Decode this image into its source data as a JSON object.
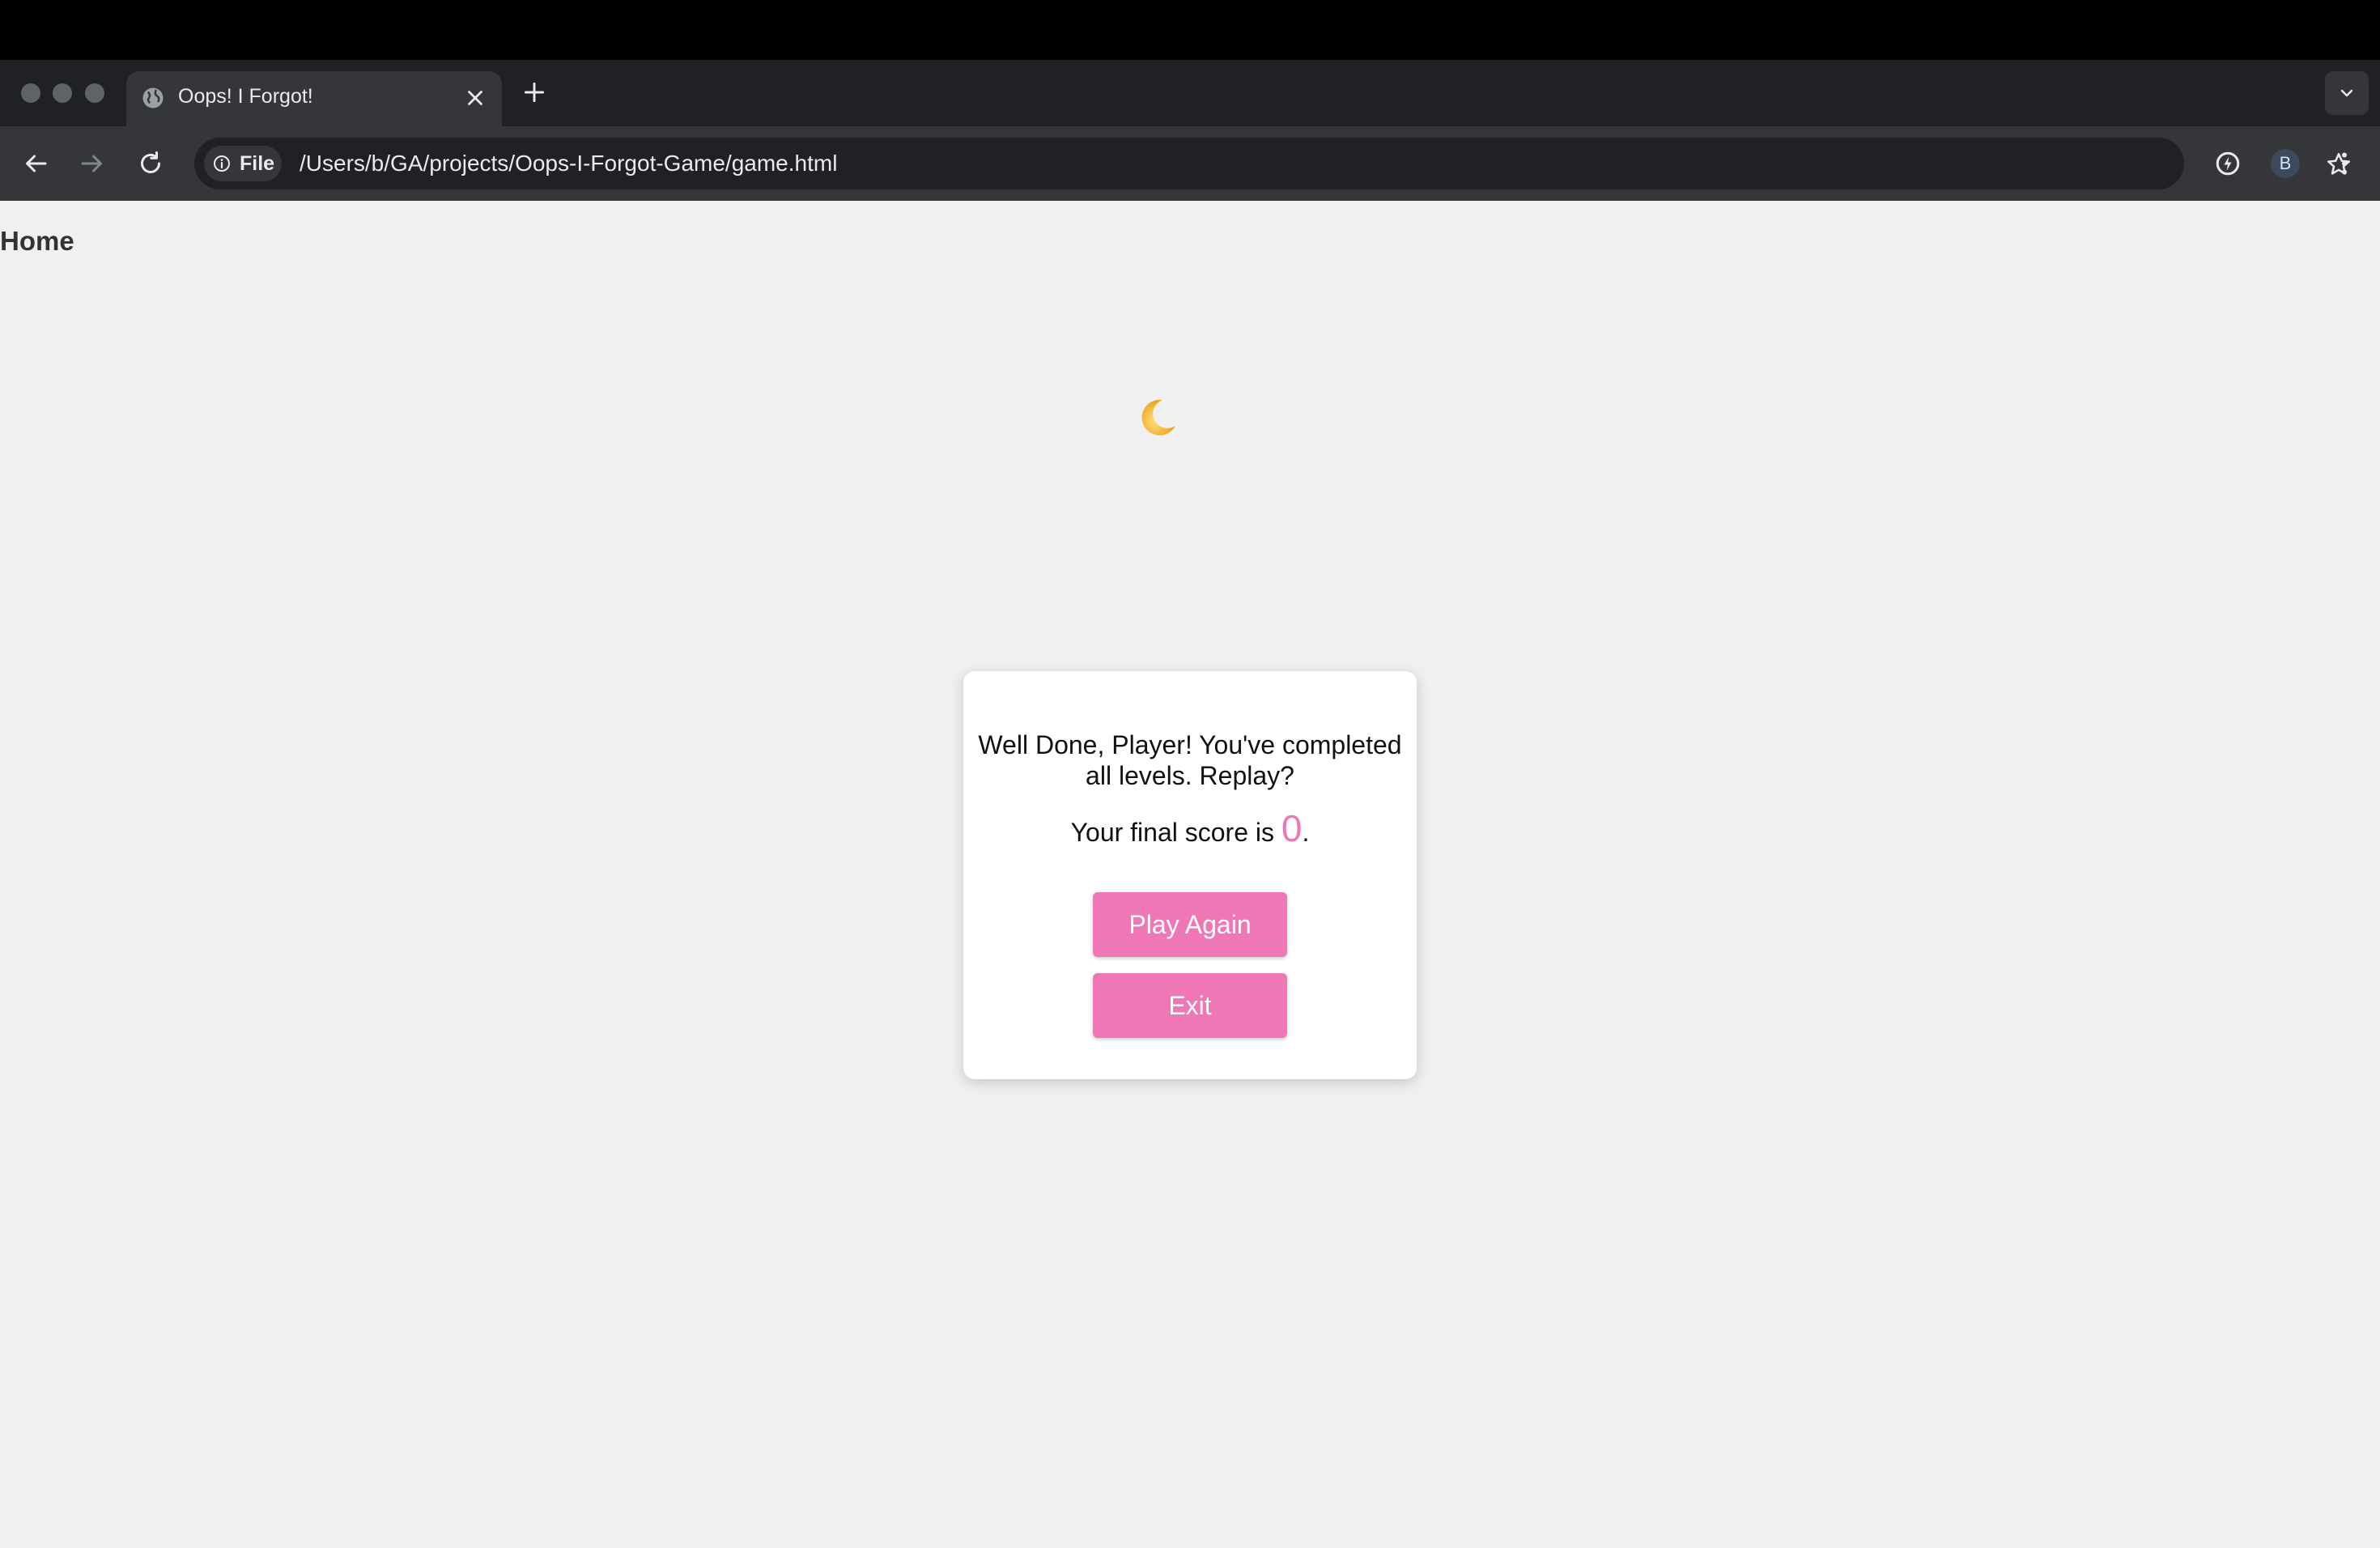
{
  "browser": {
    "tab": {
      "title": "Oops! I Forgot!",
      "icon": "globe-icon"
    },
    "address_bar": {
      "chip_label": "File",
      "url": "/Users/b/GA/projects/Oops-I-Forgot-Game/game.html"
    },
    "profile_initial": "B"
  },
  "page": {
    "nav": {
      "home_label": "Home"
    },
    "decoration": {
      "icon": "crescent-moon-icon"
    },
    "modal": {
      "message": "Well Done, Player! You've completed all levels. Replay?",
      "score_prefix": "Your final score is ",
      "score": "0",
      "score_suffix": ".",
      "play_again_label": "Play Again",
      "exit_label": "Exit"
    }
  },
  "colors": {
    "accent_pink": "#ef77b5",
    "page_background": "#f0f0f0",
    "browser_frame": "#202124"
  }
}
